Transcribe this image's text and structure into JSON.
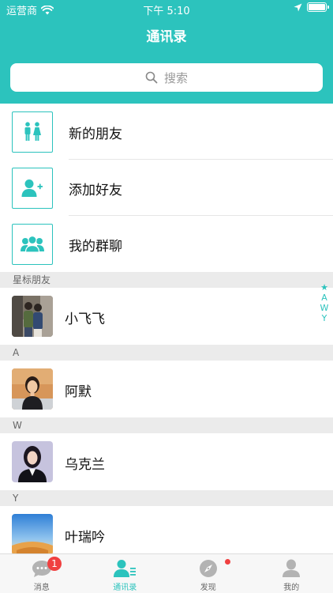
{
  "status_bar": {
    "carrier": "运营商",
    "time": "下午 5:10"
  },
  "nav": {
    "title": "通讯录"
  },
  "search": {
    "placeholder": "搜索"
  },
  "functions": [
    {
      "label": "新的朋友",
      "icon": "people-pair-icon"
    },
    {
      "label": "添加好友",
      "icon": "add-person-icon"
    },
    {
      "label": "我的群聊",
      "icon": "group-icon"
    }
  ],
  "sections": [
    {
      "header": "星标朋友",
      "contacts": [
        {
          "name": "小飞飞"
        }
      ]
    },
    {
      "header": "A",
      "contacts": [
        {
          "name": "阿默"
        }
      ]
    },
    {
      "header": "W",
      "contacts": [
        {
          "name": "乌克兰"
        }
      ]
    },
    {
      "header": "Y",
      "contacts": [
        {
          "name": "叶瑞吟"
        }
      ]
    }
  ],
  "index": [
    "★",
    "A",
    "W",
    "Y"
  ],
  "tabs": [
    {
      "label": "消息",
      "badge": "1"
    },
    {
      "label": "通讯录"
    },
    {
      "label": "发现"
    },
    {
      "label": "我的"
    }
  ],
  "colors": {
    "accent": "#2cc3bd",
    "badge": "#f04040"
  }
}
